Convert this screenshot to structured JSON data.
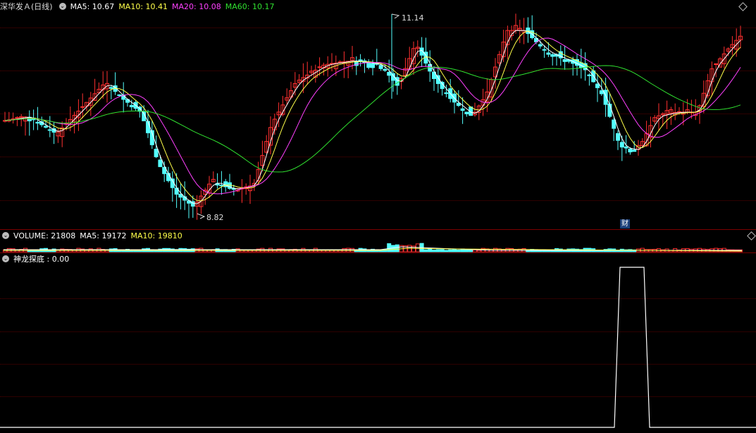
{
  "header": {
    "stock_name": "深华发Ａ(日线)",
    "ma5": "MA5: 10.67",
    "ma10": "MA10: 10.41",
    "ma20": "MA20: 10.08",
    "ma60": "MA60: 10.17"
  },
  "volume_header": {
    "title": "VOLUME: 21808",
    "ma5": "MA5: 19172",
    "ma10": "MA10: 19810"
  },
  "indicator_header": {
    "title": "神龙探底 : 0.00"
  },
  "annotations": {
    "high_label": "11.14",
    "low_label": "8.82",
    "finance_badge": "财"
  },
  "colors": {
    "up": "#ff3030",
    "down": "#54ffff",
    "ma5": "#ffffff",
    "ma10": "#ffff4a",
    "ma20": "#ff40ff",
    "ma60": "#30e030",
    "grid": "#5a0000",
    "separator": "#7a0000"
  },
  "chart_data": [
    {
      "type": "candlestick",
      "title": "深华发Ａ(日线)",
      "y_high": 11.14,
      "y_low": 8.82,
      "series": [
        {
          "name": "MA5",
          "last": 10.67
        },
        {
          "name": "MA10",
          "last": 10.41
        },
        {
          "name": "MA20",
          "last": 10.08
        },
        {
          "name": "MA60",
          "last": 10.17
        }
      ]
    },
    {
      "type": "bar",
      "title": "VOLUME",
      "last": 21808,
      "series": [
        {
          "name": "MA5",
          "last": 19172
        },
        {
          "name": "MA10",
          "last": 19810
        }
      ]
    },
    {
      "type": "line",
      "title": "神龙探底",
      "last": 0.0,
      "values": [
        0,
        0,
        0,
        0,
        0,
        0,
        0,
        0,
        0,
        0,
        0,
        0,
        0,
        0,
        0,
        0,
        0,
        0,
        0,
        0,
        0,
        0,
        0,
        0,
        0,
        0,
        0,
        0,
        0,
        0,
        0,
        0,
        0,
        0,
        0,
        0,
        0,
        0,
        0,
        0,
        0,
        0,
        0,
        0,
        0,
        0,
        0,
        0,
        0,
        0,
        0,
        0,
        0,
        0,
        0,
        0,
        0,
        0,
        0,
        0,
        0,
        0,
        0,
        0,
        0,
        0,
        0,
        0,
        0,
        0,
        0,
        0,
        0,
        0,
        0,
        0,
        0,
        0,
        0,
        0,
        0,
        0,
        0,
        0,
        0,
        0,
        0,
        0,
        0,
        0,
        0,
        0,
        0,
        0,
        0,
        0,
        0,
        0,
        0,
        0,
        0,
        0,
        0,
        0,
        0,
        0,
        0,
        0,
        0,
        0,
        0,
        0,
        0,
        0,
        0,
        0,
        0,
        0,
        0,
        0,
        0,
        0,
        0,
        0,
        0,
        0,
        0,
        0,
        0,
        0,
        0,
        0,
        0,
        0,
        0,
        0,
        0,
        0,
        0,
        0,
        0,
        0,
        0,
        0,
        0,
        0,
        0,
        0,
        0,
        0,
        0,
        0,
        0,
        0,
        0,
        0,
        0,
        0,
        0,
        0,
        0,
        0,
        0,
        0,
        1,
        1,
        1,
        1,
        1,
        1,
        1,
        0,
        0,
        0,
        0,
        0,
        0,
        0,
        0,
        0,
        0,
        0,
        0,
        0,
        0,
        0,
        0,
        0,
        0,
        0,
        0,
        0,
        0,
        0,
        0,
        0,
        0,
        0,
        0,
        0,
        0,
        0
      ]
    }
  ]
}
